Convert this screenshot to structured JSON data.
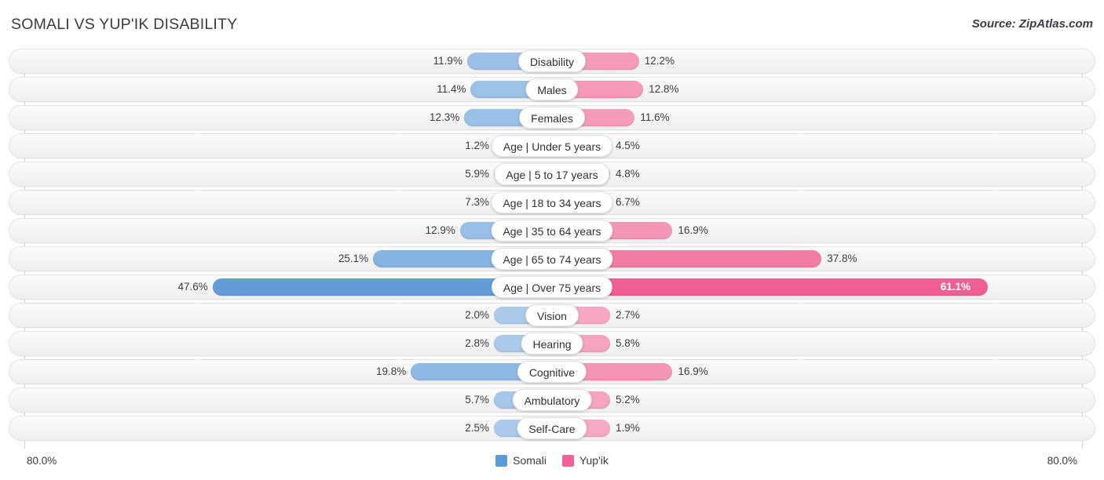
{
  "header": {
    "title": "SOMALI VS YUP'IK DISABILITY",
    "source": "Source: ZipAtlas.com"
  },
  "axis": {
    "left_label": "80.0%",
    "right_label": "80.0%",
    "max": 80.0
  },
  "legend": [
    {
      "label": "Somali",
      "color": "#5b9bd5"
    },
    {
      "label": "Yup'ik",
      "color": "#f0619a"
    }
  ],
  "chart_data": {
    "type": "bar",
    "orientation": "diverging-horizontal",
    "title": "SOMALI VS YUP'IK DISABILITY",
    "xlabel": "",
    "ylabel": "",
    "xlim": [
      80.0,
      80.0
    ],
    "grid": false,
    "legend_position": "bottom-center",
    "categories": [
      "Disability",
      "Males",
      "Females",
      "Age | Under 5 years",
      "Age | 5 to 17 years",
      "Age | 18 to 34 years",
      "Age | 35 to 64 years",
      "Age | 65 to 74 years",
      "Age | Over 75 years",
      "Vision",
      "Hearing",
      "Cognitive",
      "Ambulatory",
      "Self-Care"
    ],
    "series": [
      {
        "name": "Somali",
        "color": "#5b9bd5",
        "values": [
          11.9,
          11.4,
          12.3,
          1.2,
          5.9,
          7.3,
          12.9,
          25.1,
          47.6,
          2.0,
          2.8,
          19.8,
          5.7,
          2.5
        ],
        "labels": [
          "11.9%",
          "11.4%",
          "12.3%",
          "1.2%",
          "5.9%",
          "7.3%",
          "12.9%",
          "25.1%",
          "47.6%",
          "2.0%",
          "2.8%",
          "19.8%",
          "5.7%",
          "2.5%"
        ]
      },
      {
        "name": "Yup'ik",
        "color": "#f0619a",
        "values": [
          12.2,
          12.8,
          11.6,
          4.5,
          4.8,
          6.7,
          16.9,
          37.8,
          61.1,
          2.7,
          5.8,
          16.9,
          5.2,
          1.9
        ],
        "labels": [
          "12.2%",
          "12.8%",
          "11.6%",
          "4.5%",
          "4.8%",
          "6.7%",
          "16.9%",
          "37.8%",
          "61.1%",
          "2.7%",
          "5.8%",
          "16.9%",
          "5.2%",
          "1.9%"
        ]
      }
    ]
  },
  "rows": [
    {
      "category": "Disability",
      "left_value": "11.9%",
      "right_value": "12.2%",
      "left_num": 11.9,
      "right_num": 12.2
    },
    {
      "category": "Males",
      "left_value": "11.4%",
      "right_value": "12.8%",
      "left_num": 11.4,
      "right_num": 12.8
    },
    {
      "category": "Females",
      "left_value": "12.3%",
      "right_value": "11.6%",
      "left_num": 12.3,
      "right_num": 11.6
    },
    {
      "category": "Age | Under 5 years",
      "left_value": "1.2%",
      "right_value": "4.5%",
      "left_num": 1.2,
      "right_num": 4.5
    },
    {
      "category": "Age | 5 to 17 years",
      "left_value": "5.9%",
      "right_value": "4.8%",
      "left_num": 5.9,
      "right_num": 4.8
    },
    {
      "category": "Age | 18 to 34 years",
      "left_value": "7.3%",
      "right_value": "6.7%",
      "left_num": 7.3,
      "right_num": 6.7
    },
    {
      "category": "Age | 35 to 64 years",
      "left_value": "12.9%",
      "right_value": "16.9%",
      "left_num": 12.9,
      "right_num": 16.9
    },
    {
      "category": "Age | 65 to 74 years",
      "left_value": "25.1%",
      "right_value": "37.8%",
      "left_num": 25.1,
      "right_num": 37.8
    },
    {
      "category": "Age | Over 75 years",
      "left_value": "47.6%",
      "right_value": "61.1%",
      "left_num": 47.6,
      "right_num": 61.1
    },
    {
      "category": "Vision",
      "left_value": "2.0%",
      "right_value": "2.7%",
      "left_num": 2.0,
      "right_num": 2.7
    },
    {
      "category": "Hearing",
      "left_value": "2.8%",
      "right_value": "5.8%",
      "left_num": 2.8,
      "right_num": 5.8
    },
    {
      "category": "Cognitive",
      "left_value": "19.8%",
      "right_value": "16.9%",
      "left_num": 19.8,
      "right_num": 16.9
    },
    {
      "category": "Ambulatory",
      "left_value": "5.7%",
      "right_value": "5.2%",
      "left_num": 5.7,
      "right_num": 5.2
    },
    {
      "category": "Self-Care",
      "left_value": "2.5%",
      "right_value": "1.9%",
      "left_num": 2.5,
      "right_num": 1.9
    }
  ]
}
